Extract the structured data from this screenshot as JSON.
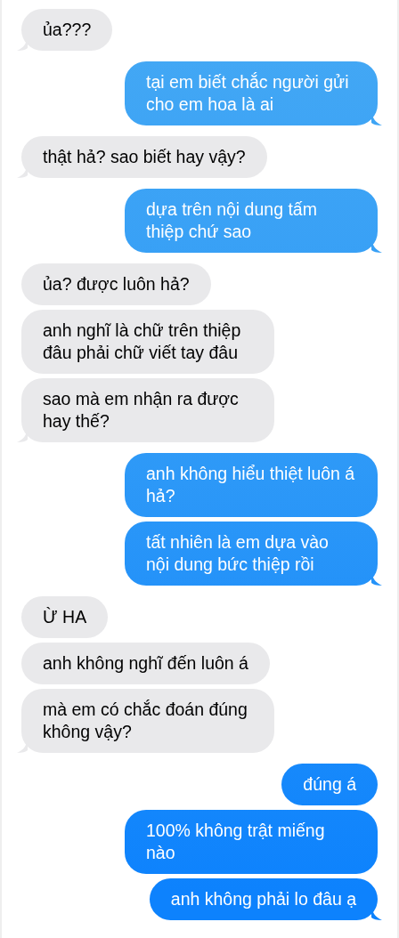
{
  "messages": [
    {
      "kind": "received",
      "text": "ủa???",
      "tail": true
    },
    {
      "kind": "sent",
      "text": "tại em biết chắc người gửi cho em hoa là ai",
      "tail": true
    },
    {
      "kind": "received",
      "text": "thật hả? sao biết hay vậy?",
      "tail": true
    },
    {
      "kind": "sent",
      "text": "dựa trên nội dung tấm thiệp chứ sao",
      "tail": true
    },
    {
      "kind": "received",
      "text": "ủa? được luôn hả?",
      "tail": false
    },
    {
      "kind": "received",
      "text": "anh nghĩ là chữ trên thiệp đâu phải chữ viết tay đâu",
      "tail": false
    },
    {
      "kind": "received",
      "text": "sao mà em nhận ra được hay thế?",
      "tail": true
    },
    {
      "kind": "sent",
      "text": "anh không hiểu thiệt luôn á hả?",
      "tail": false
    },
    {
      "kind": "sent",
      "text": "tất nhiên là em dựa vào nội dung bức thiệp rồi",
      "tail": true
    },
    {
      "kind": "received",
      "text": "Ừ HA",
      "tail": false
    },
    {
      "kind": "received",
      "text": "anh không nghĩ đến luôn á",
      "tail": false
    },
    {
      "kind": "received",
      "text": "mà em có chắc đoán đúng không vậy?",
      "tail": true
    },
    {
      "kind": "sent",
      "text": "đúng á",
      "tail": false
    },
    {
      "kind": "sent",
      "text": "100% không trật miếng nào",
      "tail": false
    },
    {
      "kind": "sent",
      "text": "anh không phải lo đâu ạ",
      "tail": true
    }
  ]
}
